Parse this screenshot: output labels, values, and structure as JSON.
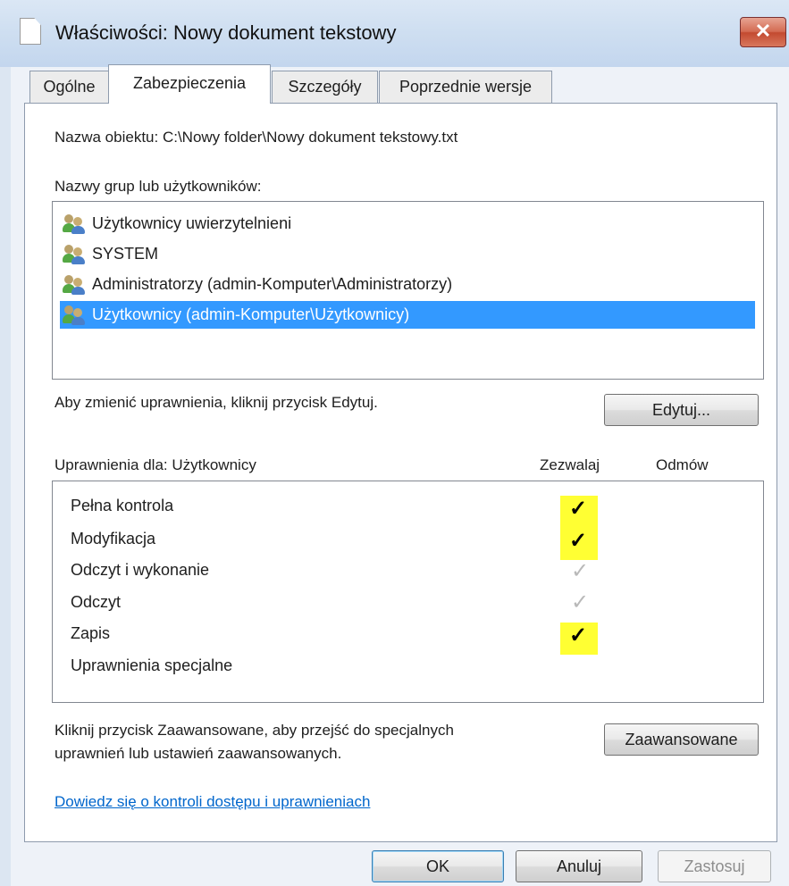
{
  "window": {
    "title": "Właściwości: Nowy dokument tekstowy",
    "close_label": "✕"
  },
  "tabs": [
    {
      "label": "Ogólne",
      "active": false
    },
    {
      "label": "Zabezpieczenia",
      "active": true
    },
    {
      "label": "Szczegóły",
      "active": false
    },
    {
      "label": "Poprzednie wersje",
      "active": false
    }
  ],
  "object_name": "Nazwa obiektu:  C:\\Nowy folder\\Nowy dokument tekstowy.txt",
  "groups_label": "Nazwy grup lub użytkowników:",
  "groups": [
    {
      "label": "Użytkownicy uwierzytelnieni",
      "icon": "users-icon",
      "selected": false
    },
    {
      "label": "SYSTEM",
      "icon": "users-icon",
      "selected": false
    },
    {
      "label": "Administratorzy (admin-Komputer\\Administratorzy)",
      "icon": "users-icon",
      "selected": false
    },
    {
      "label": "Użytkownicy (admin-Komputer\\Użytkownicy)",
      "icon": "users-icon",
      "selected": true
    }
  ],
  "edit_hint": "Aby zmienić uprawnienia, kliknij przycisk Edytuj.",
  "edit_button": "Edytuj...",
  "permissions": {
    "header": "Uprawnienia dla: Użytkownicy",
    "allow_col": "Zezwalaj",
    "deny_col": "Odmów",
    "rows": [
      {
        "label": "Pełna kontrola",
        "allow": "✓",
        "state": "checked",
        "highlighted": true
      },
      {
        "label": "Modyfikacja",
        "allow": "✓",
        "state": "checked",
        "highlighted": true
      },
      {
        "label": "Odczyt i wykonanie",
        "allow": "✓",
        "state": "inherited",
        "highlighted": false
      },
      {
        "label": "Odczyt",
        "allow": "✓",
        "state": "inherited",
        "highlighted": false
      },
      {
        "label": "Zapis",
        "allow": "✓",
        "state": "checked",
        "highlighted": true
      },
      {
        "label": "Uprawnienia specjalne",
        "allow": "",
        "state": "none",
        "highlighted": false
      }
    ],
    "highlight_color": "#ffff33"
  },
  "advanced_hint_line1": "Kliknij przycisk Zaawansowane, aby przejść do specjalnych",
  "advanced_hint_line2": "uprawnień lub ustawień zaawansowanych.",
  "advanced_button": "Zaawansowane",
  "help_link": "Dowiedz się o kontroli dostępu i uprawnieniach",
  "footer": {
    "ok": "OK",
    "cancel": "Anuluj",
    "apply": "Zastosuj"
  },
  "colors": {
    "selection": "#3399ff",
    "link": "#0066cc",
    "close_button": "#c34a30"
  }
}
